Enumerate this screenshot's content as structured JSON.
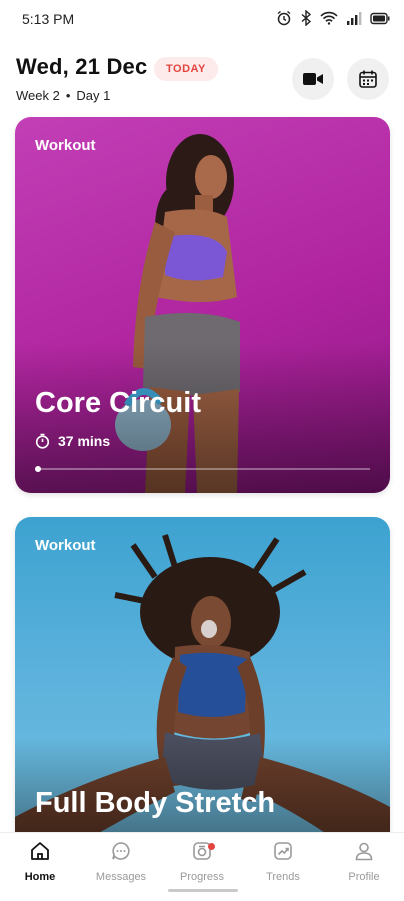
{
  "status_bar": {
    "time": "5:13 PM"
  },
  "header": {
    "date": "Wed, 21 Dec",
    "badge": "TODAY",
    "week": "Week 2",
    "day": "Day 1",
    "separator": "•"
  },
  "cards": [
    {
      "tag": "Workout",
      "title": "Core Circuit",
      "duration": "37 mins",
      "progress": 0.0
    },
    {
      "tag": "Workout",
      "title": "Full Body Stretch"
    }
  ],
  "nav": {
    "items": [
      {
        "label": "Home",
        "icon": "home-icon",
        "active": true
      },
      {
        "label": "Messages",
        "icon": "chat-icon",
        "active": false
      },
      {
        "label": "Progress",
        "icon": "progress-icon",
        "active": false,
        "has_notification": true
      },
      {
        "label": "Trends",
        "icon": "trends-icon",
        "active": false
      },
      {
        "label": "Profile",
        "icon": "profile-icon",
        "active": false
      }
    ]
  },
  "colors": {
    "accent": "#e4443f",
    "card1": "#b52aa5",
    "card2": "#4fb0dc"
  }
}
